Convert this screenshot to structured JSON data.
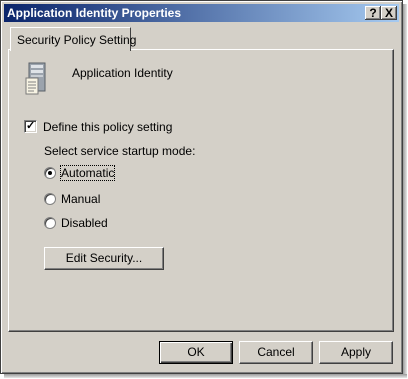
{
  "window": {
    "title": "Application Identity Properties",
    "help_glyph": "?",
    "close_glyph": "X"
  },
  "tabs": [
    {
      "label": "Security Policy Setting",
      "selected": true
    }
  ],
  "policy": {
    "service_name": "Application Identity",
    "define_checkbox": {
      "label": "Define this policy setting",
      "checked": true
    },
    "mode_prompt": "Select service startup mode:",
    "startup_modes": [
      {
        "label": "Automatic",
        "selected": true
      },
      {
        "label": "Manual",
        "selected": false
      },
      {
        "label": "Disabled",
        "selected": false
      }
    ],
    "edit_security_label": "Edit Security..."
  },
  "footer": {
    "ok_label": "OK",
    "cancel_label": "Cancel",
    "apply_label": "Apply"
  },
  "colors": {
    "dialog_face": "#d4d0c8",
    "titlebar_start": "#0a246a",
    "titlebar_end": "#a6caf0"
  },
  "icons": {
    "service": "server-icon"
  }
}
